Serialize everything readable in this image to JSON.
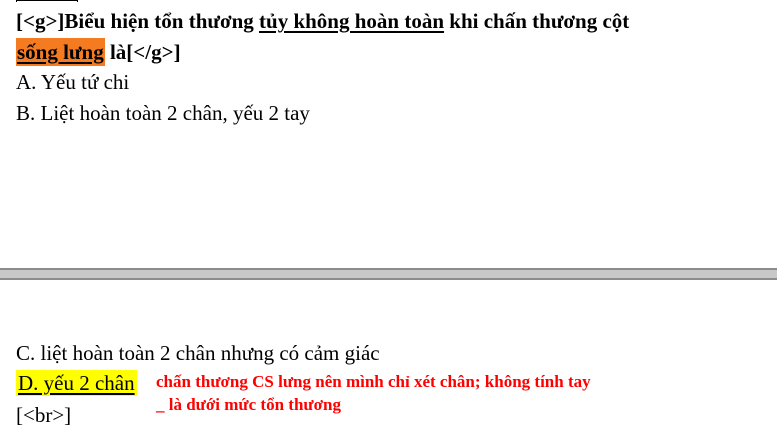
{
  "question": {
    "line1_prefix": "[<g>]Biểu hiện tổn thương ",
    "line1_underlined": "tủy không hoàn toàn",
    "line1_suffix": " khi chấn thương cột",
    "line2_highlight": "sống lưng",
    "line2_suffix": " là[</g>]"
  },
  "options": {
    "a": "A. Yếu tứ chi",
    "b": "B. Liệt hoàn toàn 2 chân, yếu 2 tay",
    "c": "C. liệt hoàn toàn 2 chân nhưng có cảm giác",
    "d": "D. yếu 2 chân"
  },
  "br_tag": "[<br>]",
  "notes": {
    "line1": "chấn thương CS lưng nên mình chỉ xét chân; không tính tay",
    "line2": "_ là dưới mức tổn thương"
  },
  "colors": {
    "orange_highlight": "#f47b20",
    "yellow_highlight": "#ffff00",
    "note_red": "#ff0000",
    "page_gap": "#c8c8c8"
  }
}
